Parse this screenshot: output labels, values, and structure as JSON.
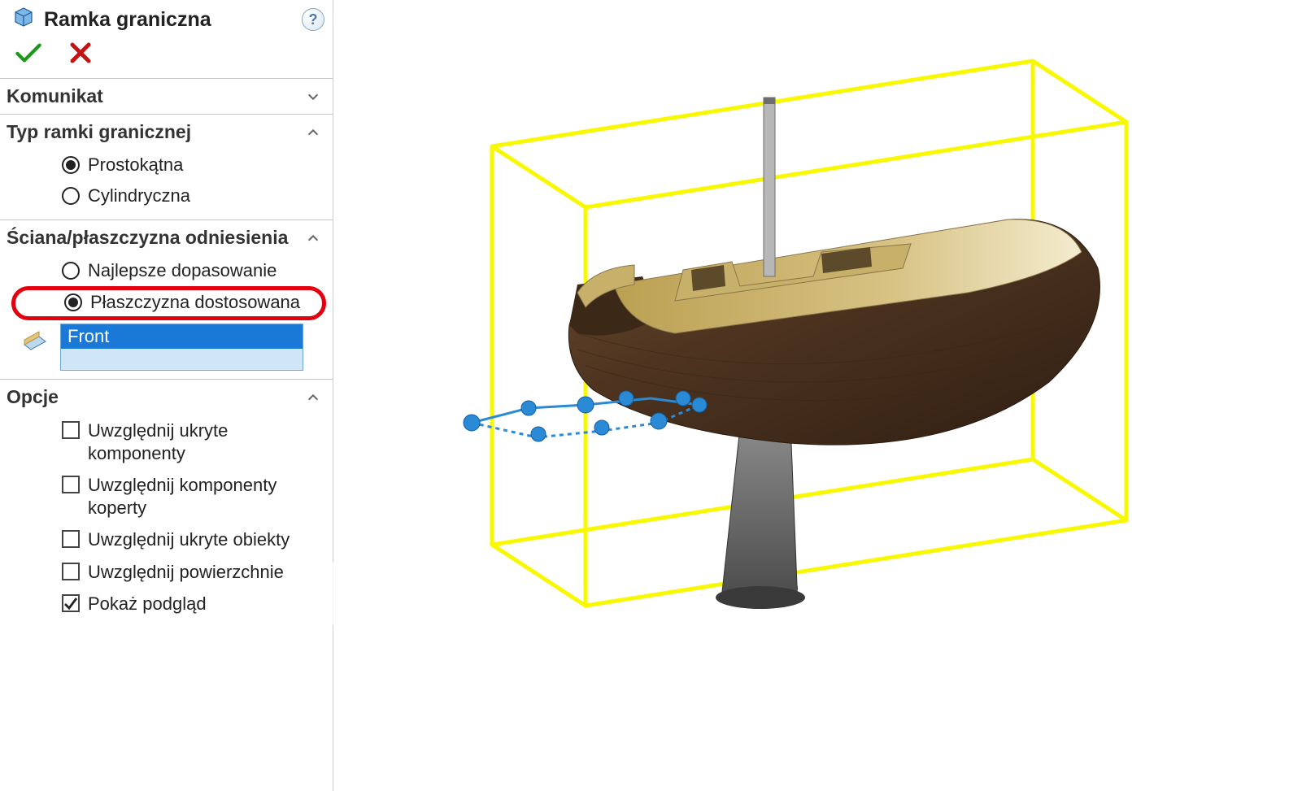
{
  "header": {
    "title": "Ramka graniczna",
    "help_tooltip": "?"
  },
  "sections": {
    "komunikat": {
      "title": "Komunikat",
      "expanded": false
    },
    "typ": {
      "title": "Typ ramki granicznej",
      "prostokatna": "Prostokątna",
      "cylindryczna": "Cylindryczna",
      "selected": "prostokatna"
    },
    "sciana": {
      "title": "Ściana/płaszczyzna odniesienia",
      "najlepsze": "Najlepsze dopasowanie",
      "dostosowana": "Płaszczyzna dostosowana",
      "selected": "dostosowana",
      "plane_value": "Front"
    },
    "opcje": {
      "title": "Opcje",
      "ukryte_komponenty": "Uwzględnij ukryte komponenty",
      "komponenty_koperty": "Uwzględnij komponenty koperty",
      "ukryte_obiekty": "Uwzględnij ukryte obiekty",
      "powierzchnie": "Uwzględnij powierzchnie",
      "podglad": "Pokaż podgląd",
      "checked": {
        "ukryte_komponenty": false,
        "komponenty_koperty": false,
        "ukryte_obiekty": false,
        "powierzchnie": false,
        "podglad": true
      }
    }
  },
  "viewport": {
    "bbox_color": "#f8f800"
  }
}
